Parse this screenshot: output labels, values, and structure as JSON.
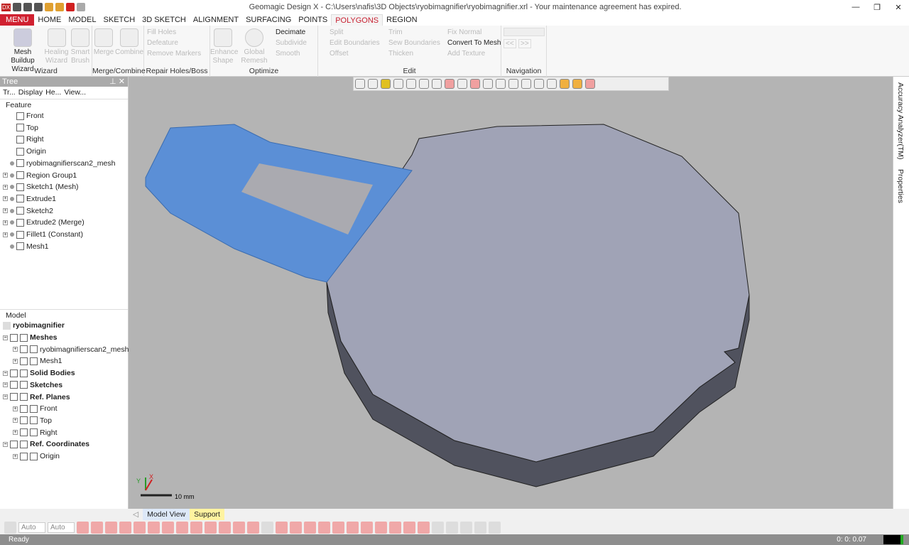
{
  "window": {
    "title": "Geomagic Design X - C:\\Users\\nafis\\3D Objects\\ryobimagnifier\\ryobimagnifier.xrl - Your maintenance agreement has expired.",
    "app_icon": "DX"
  },
  "menu_tabs": [
    "MENU",
    "HOME",
    "MODEL",
    "SKETCH",
    "3D SKETCH",
    "ALIGNMENT",
    "SURFACING",
    "POINTS",
    "POLYGONS",
    "REGION"
  ],
  "active_tab": "POLYGONS",
  "ribbon": {
    "groups": [
      "Wizard",
      "Merge/Combine",
      "Repair Holes/Boss",
      "Optimize",
      "Edit",
      "Navigation"
    ],
    "wizard": [
      "Mesh Buildup Wizard",
      "Healing Wizard",
      "Smart Brush"
    ],
    "merge": [
      "Merge",
      "Combine"
    ],
    "repair": [
      "Fill Holes",
      "Defeature",
      "Remove Markers"
    ],
    "optimize": [
      "Enhance Shape",
      "Global Remesh",
      "Decimate",
      "Subdivide",
      "Smooth"
    ],
    "edit": [
      "Split",
      "Edit Boundaries",
      "Offset",
      "Trim",
      "Sew Boundaries",
      "Thicken",
      "Fix Normal",
      "Convert To Mesh",
      "Add Texture"
    ],
    "navigation": [
      "<<",
      ">>"
    ]
  },
  "tree": {
    "title": "Tree",
    "tabs": [
      "Tr...",
      "Display",
      "He...",
      "View..."
    ],
    "feature_label": "Feature",
    "features": [
      "Front",
      "Top",
      "Right",
      "Origin",
      "ryobimagnifierscan2_mesh",
      "Region Group1",
      "Sketch1 (Mesh)",
      "Extrude1",
      "Sketch2",
      "Extrude2 (Merge)",
      "Fillet1 (Constant)",
      "Mesh1"
    ],
    "model_label": "Model",
    "model_root": "ryobimagnifier",
    "model_items": [
      "Meshes",
      "ryobimagnifierscan2_mesh",
      "Mesh1",
      "Solid Bodies",
      "Sketches",
      "Ref. Planes",
      "Front",
      "Top",
      "Right",
      "Ref. Coordinates",
      "Origin"
    ]
  },
  "viewport": {
    "scale_label": "10 mm",
    "axes": [
      "X",
      "Y"
    ],
    "mesh_color": "#5b8fd6",
    "solid_color": "#a0a3b6"
  },
  "right_panel": [
    "Accuracy Analyzer(TM)",
    "Properties"
  ],
  "bottom_tabs": [
    "Model View",
    "Support"
  ],
  "bottom_toolbar": {
    "selects": [
      "Auto",
      "Auto"
    ]
  },
  "status": {
    "text": "Ready",
    "coords": "0: 0: 0.07"
  }
}
